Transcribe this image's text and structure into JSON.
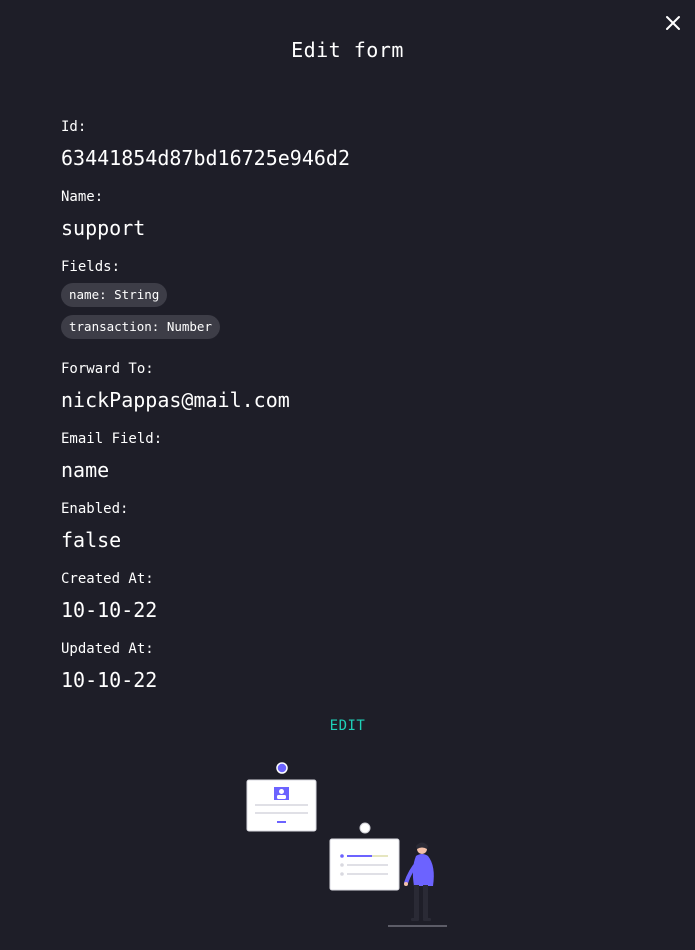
{
  "dialog": {
    "title": "Edit form",
    "close_icon": "close-icon"
  },
  "fields": {
    "id": {
      "label": "Id:",
      "value": "63441854d87bd16725e946d2"
    },
    "name": {
      "label": "Name:",
      "value": "support"
    },
    "fields": {
      "label": "Fields:",
      "chips": [
        "name: String",
        "transaction: Number"
      ]
    },
    "forward_to": {
      "label": "Forward To:",
      "value": "nickPappas@mail.com"
    },
    "email_field": {
      "label": "Email Field:",
      "value": "name"
    },
    "enabled": {
      "label": "Enabled:",
      "value": "false"
    },
    "created_at": {
      "label": "Created At:",
      "value": "10-10-22"
    },
    "updated_at": {
      "label": "Updated At:",
      "value": "10-10-22"
    }
  },
  "actions": {
    "edit_label": "EDIT"
  },
  "colors": {
    "background": "#1e1e28",
    "accent": "#1fd1b8",
    "chip_bg": "#3d3d47",
    "illustration_purple": "#6c63ff"
  }
}
